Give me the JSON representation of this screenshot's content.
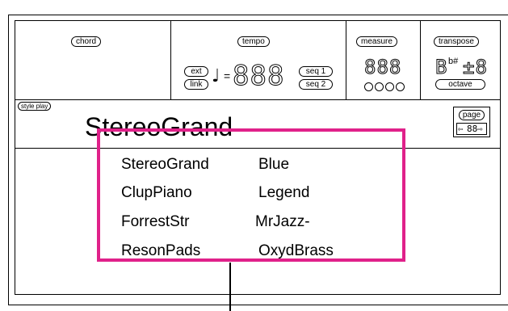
{
  "top_display": {
    "chord_label": "chord",
    "tempo": {
      "label": "tempo",
      "ext_label": "ext",
      "link_label": "link",
      "note_symbol": "♩",
      "equals": "=",
      "value_digits": "888",
      "seq1_label": "seq 1",
      "seq2_label": "seq 2"
    },
    "measure": {
      "label": "measure",
      "digits": "888"
    },
    "transpose": {
      "label": "transpose",
      "note_digit": "B",
      "accidentals": "b#",
      "sign_digit": "±8",
      "octave_label": "octave"
    }
  },
  "style_play": {
    "tag": "style play",
    "name": "StereoGrand",
    "page_label": "page",
    "page_left_arrow": "⇦",
    "page_digits": "88",
    "page_right_arrow": "⇨"
  },
  "style_list": {
    "col1": [
      "StereoGrand",
      "ClupPiano",
      "ForrestStr",
      "ResonPads"
    ],
    "col2": [
      "Blue",
      "Legend",
      "MrJazz-",
      "OxydBrass"
    ]
  },
  "colors": {
    "highlight": "#e0218a"
  }
}
